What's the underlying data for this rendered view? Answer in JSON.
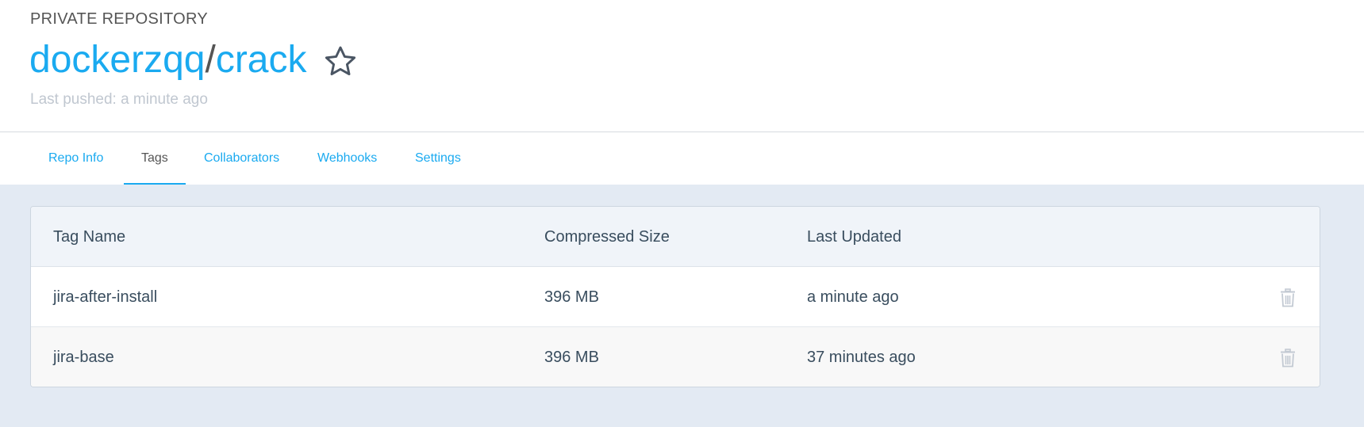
{
  "header": {
    "repo_type": "PRIVATE REPOSITORY",
    "namespace": "dockerzqq",
    "separator": "/",
    "repo_name": "crack",
    "last_pushed": "Last pushed: a minute ago"
  },
  "tabs": [
    {
      "label": "Repo Info",
      "active": false
    },
    {
      "label": "Tags",
      "active": true
    },
    {
      "label": "Collaborators",
      "active": false
    },
    {
      "label": "Webhooks",
      "active": false
    },
    {
      "label": "Settings",
      "active": false
    }
  ],
  "table": {
    "columns": [
      "Tag Name",
      "Compressed Size",
      "Last Updated"
    ],
    "rows": [
      {
        "tag": "jira-after-install",
        "size": "396 MB",
        "updated": "a minute ago"
      },
      {
        "tag": "jira-base",
        "size": "396 MB",
        "updated": "37 minutes ago"
      }
    ]
  },
  "icons": {
    "star": "star-outline-icon",
    "delete": "trash-icon"
  },
  "colors": {
    "accent": "#1aaaf0",
    "text": "#394d5e",
    "muted": "#c0c7d0",
    "background": "#e3eaf3"
  }
}
